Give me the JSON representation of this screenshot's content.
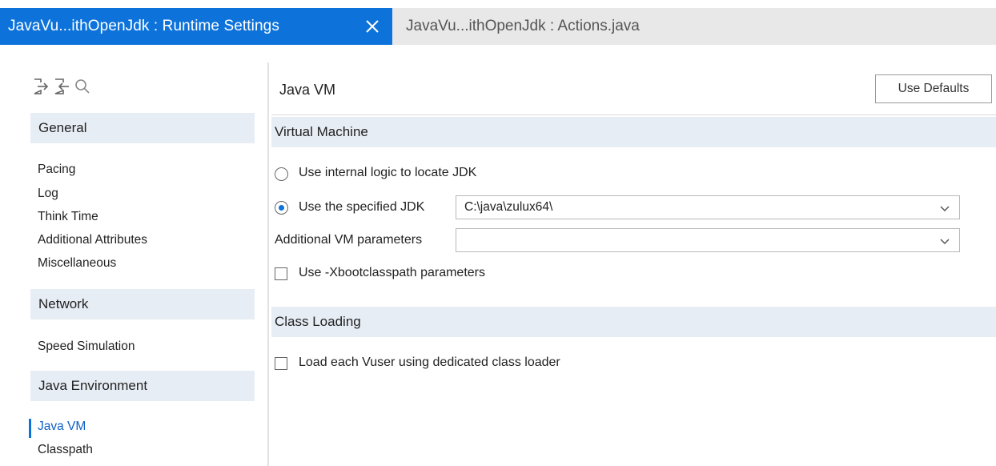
{
  "tabs": {
    "active_label": "JavaVu...ithOpenJdk : Runtime Settings",
    "inactive_label": "JavaVu...ithOpenJdk : Actions.java"
  },
  "sidebar": {
    "tools": [
      "export-icon",
      "import-icon",
      "search-icon"
    ],
    "sections": [
      {
        "title": "General",
        "items": [
          "Pacing",
          "Log",
          "Think Time",
          "Additional Attributes",
          "Miscellaneous"
        ]
      },
      {
        "title": "Network",
        "items": [
          "Speed Simulation"
        ]
      },
      {
        "title": "Java Environment",
        "items": [
          "Java VM",
          "Classpath"
        ]
      }
    ],
    "active_item": "Java VM"
  },
  "panel": {
    "title": "Java VM",
    "use_defaults_label": "Use Defaults",
    "virtual_machine": {
      "header": "Virtual Machine",
      "radio_internal_label": "Use internal logic to locate JDK",
      "radio_specified_label": "Use the specified JDK",
      "jdk_path": "C:\\java\\zulux64\\",
      "vm_params_label": "Additional VM parameters",
      "vm_params_value": "",
      "xboot_label": "Use -Xbootclasspath parameters",
      "selected_option": "Use the specified JDK",
      "xboot_checked": false
    },
    "class_loading": {
      "header": "Class Loading",
      "dedicated_loader_label": "Load each Vuser using dedicated class loader",
      "dedicated_loader_checked": false
    }
  },
  "colors": {
    "accent": "#0d73db",
    "section_bg": "#e7edf5",
    "tabbar_bg": "#e8e8e8"
  }
}
